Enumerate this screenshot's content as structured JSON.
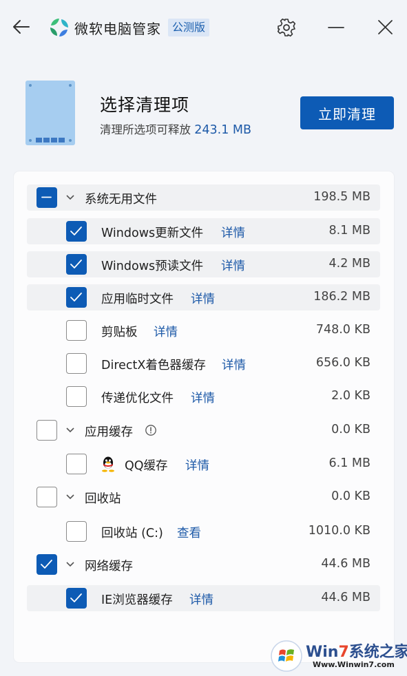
{
  "titlebar": {
    "app_title": "微软电脑管家",
    "badge": "公测版"
  },
  "header": {
    "title": "选择清理项",
    "subtitle_prefix": "清理所选项可释放",
    "subtitle_size": "243.1 MB",
    "clean_button": "立即清理"
  },
  "rows": [
    {
      "label": "系统无用文件",
      "size": "198.5 MB",
      "state": "partial"
    },
    {
      "label": "Windows更新文件",
      "link": "详情",
      "size": "8.1 MB",
      "state": "checked"
    },
    {
      "label": "Windows预读文件",
      "link": "详情",
      "size": "4.2 MB",
      "state": "checked"
    },
    {
      "label": "应用临时文件",
      "link": "详情",
      "size": "186.2 MB",
      "state": "checked"
    },
    {
      "label": "剪贴板",
      "link": "详情",
      "size": "748.0 KB",
      "state": "unchecked"
    },
    {
      "label": "DirectX着色器缓存",
      "link": "详情",
      "size": "656.0 KB",
      "state": "unchecked"
    },
    {
      "label": "传递优化文件",
      "link": "详情",
      "size": "2.0 KB",
      "state": "unchecked"
    },
    {
      "label": "应用缓存",
      "size": "0.0 KB",
      "state": "unchecked"
    },
    {
      "label": "QQ缓存",
      "link": "详情",
      "size": "6.1 MB",
      "state": "unchecked"
    },
    {
      "label": "回收站",
      "size": "0.0 KB",
      "state": "unchecked"
    },
    {
      "label": "回收站 (C:)",
      "link": "查看",
      "size": "1010.0 KB",
      "state": "unchecked"
    },
    {
      "label": "网络缓存",
      "size": "44.6 MB",
      "state": "checked"
    },
    {
      "label": "IE浏览器缓存",
      "link": "详情",
      "size": "44.6 MB",
      "state": "checked"
    }
  ],
  "watermark": {
    "text_win": "Win",
    "text_7": "7",
    "text_rest": "系统之家",
    "url": "Www.Winwin7.com"
  },
  "colors": {
    "accent": "#0d5bb5",
    "link": "#1e5aa8",
    "background": "#f2f4f8"
  }
}
